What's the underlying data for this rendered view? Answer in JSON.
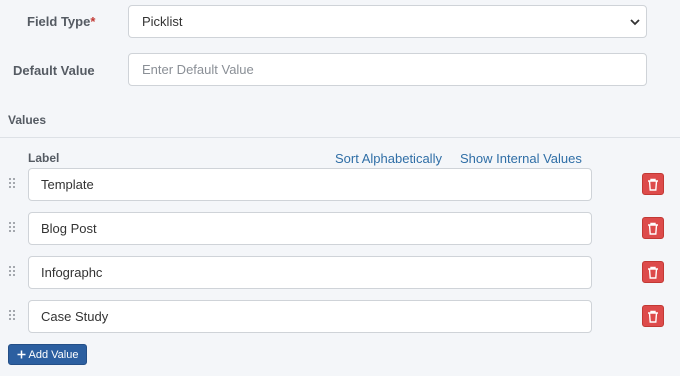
{
  "form": {
    "field_type_label": "Field Type",
    "required_marker": "*",
    "field_type_value": "Picklist",
    "default_value_label": "Default Value",
    "default_value_placeholder": "Enter Default Value"
  },
  "values_section": {
    "title": "Values",
    "column_label": "Label",
    "sort_link": "Sort Alphabetically",
    "internal_link": "Show Internal Values",
    "rows": [
      {
        "label": "Template"
      },
      {
        "label": "Blog Post"
      },
      {
        "label": "Infographc"
      },
      {
        "label": "Case Study"
      }
    ],
    "add_button": "Add Value"
  },
  "colors": {
    "link": "#2f6ea6",
    "delete": "#dd4b4b",
    "primary": "#2c5fa0",
    "required": "#c23934"
  },
  "icons": {
    "select": "chevron-down-icon",
    "drag": "drag-handle-icon",
    "delete": "trash-icon",
    "add": "plus-icon"
  }
}
